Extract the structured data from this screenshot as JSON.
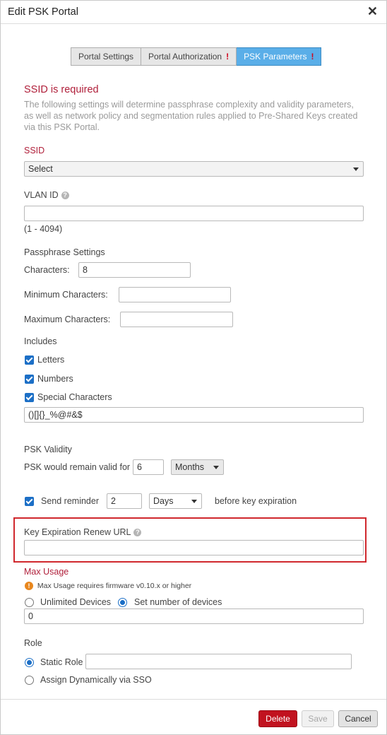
{
  "dialog": {
    "title": "Edit PSK Portal"
  },
  "tabs": [
    {
      "label": "Portal Settings",
      "warning": ""
    },
    {
      "label": "Portal Authorization",
      "warning": "!"
    },
    {
      "label": "PSK Parameters",
      "warning": "!"
    }
  ],
  "intro": {
    "error": "SSID is required",
    "description": "The following settings will determine passphrase complexity and validity parameters, as well as network policy and segmentation rules applied to Pre-Shared Keys created via this PSK Portal."
  },
  "ssid": {
    "label": "SSID",
    "value": "Select"
  },
  "vlan": {
    "label": "VLAN ID",
    "value": "",
    "range": "(1 - 4094)"
  },
  "passphrase": {
    "heading": "Passphrase Settings",
    "characters_label": "Characters:",
    "characters_value": "8",
    "min_label": "Minimum Characters:",
    "min_value": "",
    "max_label": "Maximum Characters:",
    "max_value": ""
  },
  "includes": {
    "heading": "Includes",
    "letters": "Letters",
    "numbers": "Numbers",
    "special": "Special Characters",
    "special_value": "()[]{}_%@#&$"
  },
  "validity": {
    "heading": "PSK Validity",
    "label": "PSK would remain valid for",
    "value": "6",
    "unit": "Months"
  },
  "reminder": {
    "label": "Send reminder",
    "value": "2",
    "unit": "Days",
    "suffix": "before key expiration"
  },
  "renew_url": {
    "label": "Key Expiration Renew URL",
    "value": ""
  },
  "max_usage": {
    "heading": "Max Usage",
    "note": "Max Usage requires firmware v0.10.x or higher",
    "unlimited": "Unlimited Devices",
    "set_number": "Set number of devices",
    "value": "0"
  },
  "role": {
    "heading": "Role",
    "static": "Static Role",
    "static_value": "",
    "dynamic": "Assign Dynamically via SSO"
  },
  "footer": {
    "delete": "Delete",
    "save": "Save",
    "cancel": "Cancel"
  },
  "colors": {
    "accent": "#1c6fc6",
    "error": "#b01f3a",
    "delete": "#c1121f",
    "active_tab": "#5aaee8"
  },
  "icons": {
    "close": "close-icon",
    "help": "help-icon",
    "warning": "warning-icon",
    "caret": "chevron-down-icon"
  }
}
